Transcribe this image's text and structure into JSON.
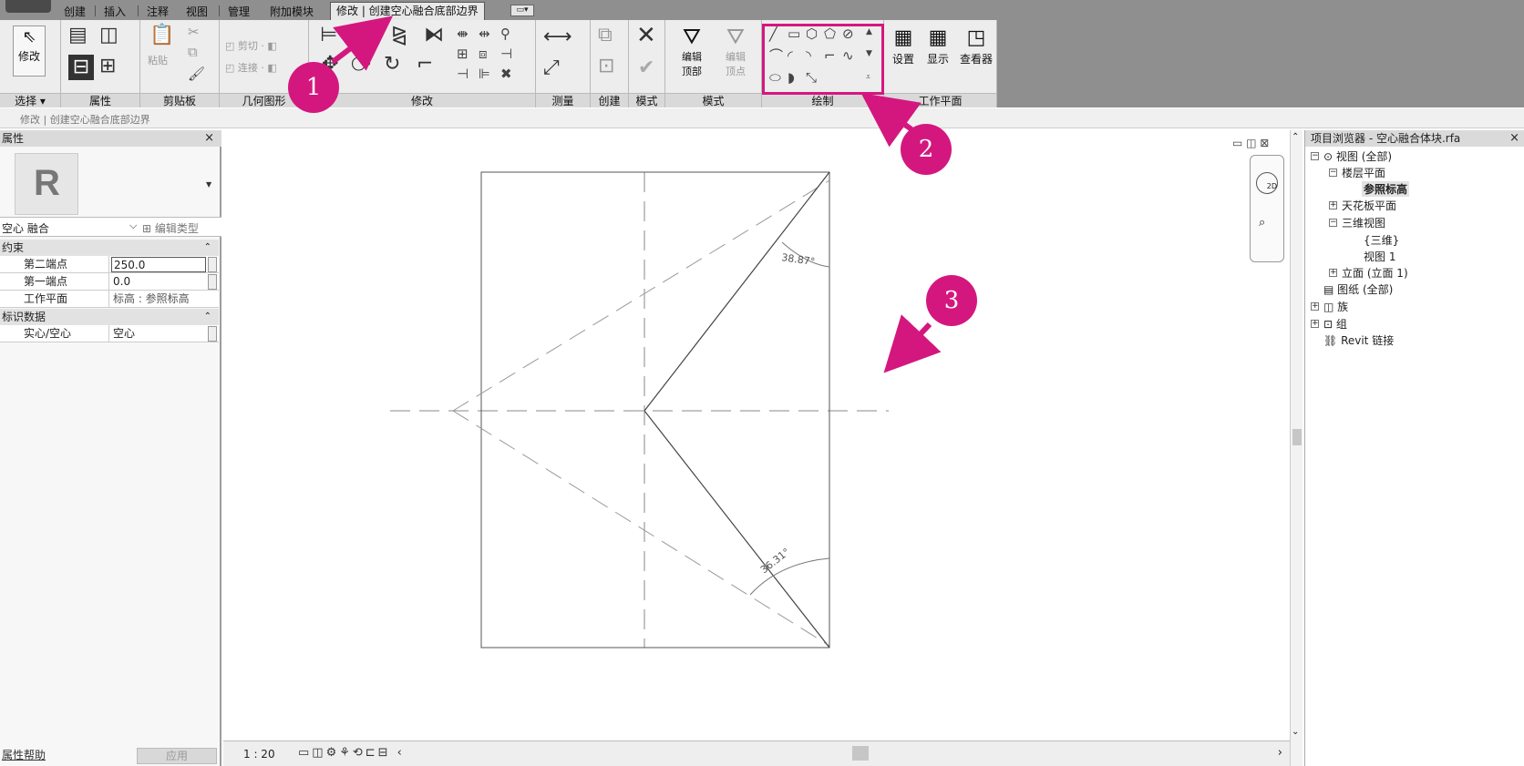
{
  "tabs": {
    "items": [
      "创建",
      "插入",
      "注释",
      "视图",
      "管理",
      "附加模块",
      "修改 | 创建空心融合底部边界"
    ],
    "minimize": "▭▾"
  },
  "ribbon": {
    "select": {
      "modify_label": "修改",
      "panel_label": "选择 ▾"
    },
    "properties": {
      "panel_label": "属性"
    },
    "clipboard": {
      "paste_label": "粘贴",
      "panel_label": "剪贴板"
    },
    "geometry": {
      "cut_label": "剪切 ·",
      "join_label": "连接 ·",
      "panel_label": "几何图形"
    },
    "modify": {
      "panel_label": "修改"
    },
    "measure": {
      "panel_label": "测量"
    },
    "create": {
      "panel_label": "创建"
    },
    "mode": {
      "panel_label": "模式"
    },
    "mode2": {
      "edit_top_label_1": "编辑",
      "edit_top_label_2": "顶部",
      "edit_vertex_label_1": "编辑",
      "edit_vertex_label_2": "顶点",
      "panel_label": "模式"
    },
    "draw": {
      "panel_label": "绘制"
    },
    "workplane": {
      "set_label": "设置",
      "show_label": "显示",
      "viewer_label": "查看器",
      "panel_label": "工作平面"
    }
  },
  "context_bar": {
    "text": "修改 | 创建空心融合底部边界"
  },
  "properties": {
    "title": "属性",
    "close": "×",
    "family_type": "空心 融合",
    "edit_type": "编辑类型",
    "groups": [
      {
        "name": "约束",
        "rows": [
          {
            "key": "第二端点",
            "value": "250.0"
          },
          {
            "key": "第一端点",
            "value": "0.0"
          },
          {
            "key": "工作平面",
            "value": "标高 : 参照标高"
          }
        ]
      },
      {
        "name": "标识数据",
        "rows": [
          {
            "key": "实心/空心",
            "value": "空心"
          }
        ]
      }
    ],
    "help": "属性帮助",
    "apply": "应用"
  },
  "canvas": {
    "angle_top": "38.87°",
    "angle_bottom": "36.31°",
    "scale": "1 : 20"
  },
  "browser": {
    "title": "项目浏览器 - 空心融合体块.rfa",
    "close": "×",
    "nodes": {
      "views": "视图 (全部)",
      "floor_plans": "楼层平面",
      "ref_level": "参照标高",
      "ceiling_plans": "天花板平面",
      "views_3d": "三维视图",
      "view_3d": "{三维}",
      "view_1": "视图 1",
      "elevations": "立面 (立面 1)",
      "sheets": "图纸 (全部)",
      "families": "族",
      "groups": "组",
      "revit_links": "Revit 链接"
    }
  },
  "callouts": [
    "1",
    "2",
    "3"
  ],
  "colors": {
    "accent": "#d4177f",
    "ribbon_dark": "#8f8f8f"
  }
}
